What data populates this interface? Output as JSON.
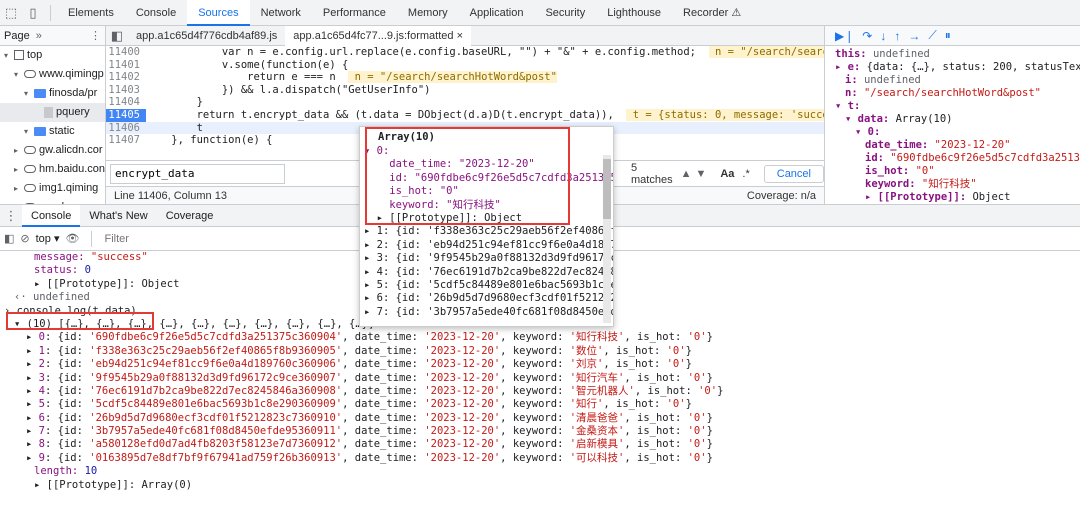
{
  "topbar": {
    "tabs": [
      {
        "label": "Elements"
      },
      {
        "label": "Console"
      },
      {
        "label": "Sources",
        "active": true
      },
      {
        "label": "Network"
      },
      {
        "label": "Performance"
      },
      {
        "label": "Memory"
      },
      {
        "label": "Application"
      },
      {
        "label": "Security"
      },
      {
        "label": "Lighthouse"
      },
      {
        "label": "Recorder ⚠"
      }
    ]
  },
  "navigator": {
    "tab": "Page",
    "more": "»",
    "tree": [
      {
        "label": "top",
        "type": "square",
        "depth": 0
      },
      {
        "label": "www.qimingp",
        "type": "cloud",
        "depth": 1
      },
      {
        "label": "finosda/pr",
        "type": "folder",
        "depth": 2
      },
      {
        "label": "pquery",
        "type": "file",
        "depth": 3,
        "selected": true
      },
      {
        "label": "static",
        "type": "folder",
        "depth": 2
      },
      {
        "label": "gw.alicdn.cor",
        "type": "cloud",
        "depth": 1
      },
      {
        "label": "hm.baidu.con",
        "type": "cloud",
        "depth": 1
      },
      {
        "label": "img1.qiming",
        "type": "cloud",
        "depth": 1
      },
      {
        "label": "wx.qlogo.cn",
        "type": "cloud",
        "depth": 1
      }
    ]
  },
  "editor": {
    "tabs": [
      {
        "label": "app.a1c65d4f776cdb4af89.js",
        "active": false
      },
      {
        "label": "app.a1c65d4fc77...9.js:formatted ×",
        "active": true
      }
    ],
    "lines": [
      {
        "no": "11400",
        "text": "            var n = e.config.url.replace(e.config.baseURL, \"\") + \"&\" + e.config.method;",
        "hint": " n = \"/search/searchHotWord&"
      },
      {
        "no": "11401",
        "text": "            v.some(function(e) {",
        "hint": ""
      },
      {
        "no": "11402",
        "text": "                return e === n",
        "hint": " n = \"/search/searchHotWord&post\""
      },
      {
        "no": "11403",
        "text": "            }) && l.a.dispatch(\"GetUserInfo\")",
        "hint": ""
      },
      {
        "no": "11404",
        "text": "        }",
        "hint": ""
      },
      {
        "no": "11405",
        "text": "        return t.encrypt_data && (t.data = DObject(d.a)D(t.encrypt_data)),",
        "hint": " t = {status: 0, message: 'success', e",
        "bp": true
      },
      {
        "no": "11406",
        "text": "        t",
        "hint": "",
        "current": true
      },
      {
        "no": "11407",
        "text": "    }, function(e) {",
        "hint": ""
      }
    ],
    "search_value": "encrypt_data",
    "matches": "5 matches",
    "aa": "Aa",
    "regex": ".*",
    "cancel": "Cancel",
    "status": "Line 11406, Column 13",
    "coverage": "Coverage: n/a"
  },
  "scope": {
    "lines": [
      {
        "indent": 0,
        "key": "this:",
        "val": "undefined",
        "vtype": "gray"
      },
      {
        "indent": 0,
        "key": "▸ e:",
        "val": "{data: {…}, status: 200, statusText: 'O",
        "vtype": "plain"
      },
      {
        "indent": 1,
        "key": "i:",
        "val": "undefined",
        "vtype": "gray"
      },
      {
        "indent": 1,
        "key": "n:",
        "val": "\"/search/searchHotWord&post\"",
        "vtype": "str"
      },
      {
        "indent": 0,
        "key": "▾ t:",
        "val": "",
        "vtype": "plain"
      },
      {
        "indent": 1,
        "key": "▾ data:",
        "val": "Array(10)",
        "vtype": "plain"
      },
      {
        "indent": 2,
        "key": "▾ 0:",
        "val": "",
        "vtype": "plain"
      },
      {
        "indent": 3,
        "key": "date_time:",
        "val": "\"2023-12-20\"",
        "vtype": "str"
      },
      {
        "indent": 3,
        "key": "id:",
        "val": "\"690fdbe6c9f26e5d5c7cdfd3a251375c\"",
        "vtype": "str"
      },
      {
        "indent": 3,
        "key": "is_hot:",
        "val": "\"0\"",
        "vtype": "str"
      },
      {
        "indent": 3,
        "key": "keyword:",
        "val": "\"知行科技\"",
        "vtype": "str"
      },
      {
        "indent": 3,
        "key": "▸ [[Prototype]]:",
        "val": "Object",
        "vtype": "plain"
      }
    ]
  },
  "drawer": {
    "tabs": [
      {
        "label": "Console",
        "active": true
      },
      {
        "label": "What's New"
      },
      {
        "label": "Coverage"
      }
    ],
    "context": "top ▾",
    "filter_placeholder": "Filter",
    "lines": [
      {
        "kind": "prop",
        "key": "message:",
        "val": "\"success\"",
        "vt": "str"
      },
      {
        "kind": "prop",
        "key": "status:",
        "val": "0",
        "vt": "num"
      },
      {
        "kind": "plain",
        "text": "▸ [[Prototype]]: Object"
      },
      {
        "kind": "out",
        "text": "‹· undefined"
      },
      {
        "kind": "in",
        "text": "› console.log(t.data)"
      },
      {
        "kind": "plain",
        "text": "▾ (10) [{…}, {…}, {…}, {…}, {…}, {…}, {…}, {…}, {…}, {…}]"
      },
      {
        "kind": "row",
        "i": "0",
        "id": "'690fdbe6c9f26e5d5c7cdfd3a251375c360904'",
        "date": "'2023-12-20'",
        "kw": "'知行科技'",
        "hot": "'0'"
      },
      {
        "kind": "row",
        "i": "1",
        "id": "'f338e363c25c29aeb56f2ef40865f8b9360905'",
        "date": "'2023-12-20'",
        "kw": "'数位'",
        "hot": "'0'"
      },
      {
        "kind": "row",
        "i": "2",
        "id": "'eb94d251c94ef81cc9f6e0a4d189760c360906'",
        "date": "'2023-12-20'",
        "kw": "'刘京'",
        "hot": "'0'"
      },
      {
        "kind": "row",
        "i": "3",
        "id": "'9f9545b29a0f88132d3d9fd96172c9ce360907'",
        "date": "'2023-12-20'",
        "kw": "'知行汽车'",
        "hot": "'0'"
      },
      {
        "kind": "row",
        "i": "4",
        "id": "'76ec6191d7b2ca9be822d7ec8245846a360908'",
        "date": "'2023-12-20'",
        "kw": "'智元机器人'",
        "hot": "'0'"
      },
      {
        "kind": "row",
        "i": "5",
        "id": "'5cdf5c84489e801e6bac5693b1c8e290360909'",
        "date": "'2023-12-20'",
        "kw": "'知行'",
        "hot": "'0'"
      },
      {
        "kind": "row",
        "i": "6",
        "id": "'26b9d5d7d9680ecf3cdf01f5212823c7360910'",
        "date": "'2023-12-20'",
        "kw": "'清晨爸爸'",
        "hot": "'0'"
      },
      {
        "kind": "row",
        "i": "7",
        "id": "'3b7957a5ede40fc681f08d8450efde95360911'",
        "date": "'2023-12-20'",
        "kw": "'金桑资本'",
        "hot": "'0'"
      },
      {
        "kind": "row",
        "i": "8",
        "id": "'a580128efd0d7ad4fb8203f58123e7d7360912'",
        "date": "'2023-12-20'",
        "kw": "'启新模具'",
        "hot": "'0'"
      },
      {
        "kind": "row",
        "i": "9",
        "id": "'0163895d7e8df7bf9f67941ad759f26b360913'",
        "date": "'2023-12-20'",
        "kw": "'可以科技'",
        "hot": "'0'"
      },
      {
        "kind": "prop",
        "key": "length:",
        "val": "10",
        "vt": "num"
      },
      {
        "kind": "plain",
        "text": "▸ [[Prototype]]: Array(0)"
      }
    ]
  },
  "popup": {
    "title": "Array(10)",
    "lines": [
      {
        "t": "▾ 0:",
        "cls": "idx"
      },
      {
        "t": "    date_time: \"2023-12-20\"",
        "cls": "pk2"
      },
      {
        "t": "    id: \"690fdbe6c9f26e5d5c7cdfd3a251375c3",
        "cls": "pk2"
      },
      {
        "t": "    is_hot: \"0\"",
        "cls": "pk2"
      },
      {
        "t": "    keyword: \"知行科技\"",
        "cls": "pk2"
      },
      {
        "t": "  ▸ [[Prototype]]: Object",
        "cls": "plain"
      },
      {
        "t": "▸ 1: {id: 'f338e363c25c29aeb56f2ef40865f8b",
        "cls": "row"
      },
      {
        "t": "▸ 2: {id: 'eb94d251c94ef81cc9f6e0a4d189760",
        "cls": "row"
      },
      {
        "t": "▸ 3: {id: '9f9545b29a0f88132d3d9fd96172c9c",
        "cls": "row"
      },
      {
        "t": "▸ 4: {id: '76ec6191d7b2ca9be822d7ec824584",
        "cls": "row"
      },
      {
        "t": "▸ 5: {id: '5cdf5c84489e801e6bac5693b1c8e29",
        "cls": "row"
      },
      {
        "t": "▸ 6: {id: '26b9d5d7d9680ecf3cdf01f5212823c",
        "cls": "row"
      },
      {
        "t": "▸ 7: {id: '3b7957a5ede40fc681f08d8450efde9",
        "cls": "row"
      }
    ]
  },
  "colors": {
    "accent": "#1a73e8",
    "highlight_box": "#e53935",
    "breakpoint": "#4285f4"
  }
}
